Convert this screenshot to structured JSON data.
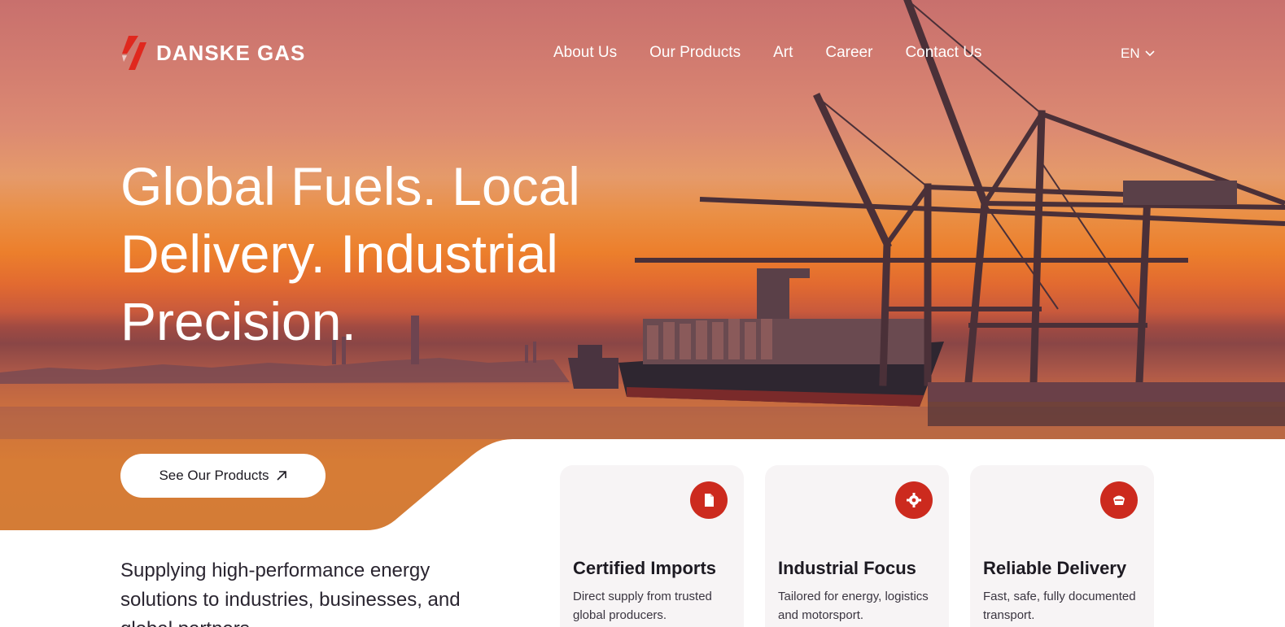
{
  "brand": {
    "name": "DANSKE GAS",
    "accent": "#e0281e"
  },
  "nav": {
    "items": [
      {
        "label": "About Us"
      },
      {
        "label": "Our Products"
      },
      {
        "label": "Art"
      },
      {
        "label": "Career"
      },
      {
        "label": "Contact Us"
      }
    ],
    "language": "EN"
  },
  "hero": {
    "headline": "Global Fuels. Local Delivery. Industrial Precision.",
    "cta_label": "See Our Products"
  },
  "tagline": "Supplying high-performance energy solutions to industries, businesses, and global partners.",
  "features": [
    {
      "title": "Certified Imports",
      "description": "Direct supply from trusted global producers.",
      "icon": "document-icon"
    },
    {
      "title": "Industrial Focus",
      "description": "Tailored for energy, logistics and motorsport.",
      "icon": "gear-icon"
    },
    {
      "title": "Reliable Delivery",
      "description": "Fast, safe, fully documented transport.",
      "icon": "delivery-icon"
    }
  ]
}
